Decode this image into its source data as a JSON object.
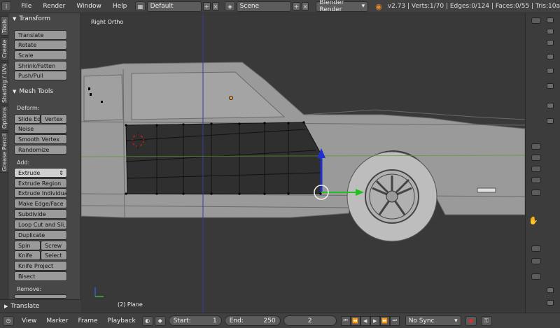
{
  "topbar": {
    "menus": [
      "File",
      "Render",
      "Window",
      "Help"
    ],
    "layout": "Default",
    "scene": "Scene",
    "engine": "Blender Render",
    "stats": "v2.73 | Verts:1/70 | Edges:0/124 | Faces:0/55 | Tris:10a"
  },
  "vtabs": [
    "Tools",
    "Create",
    "Shading / UVs",
    "Options",
    "Grease Pencil"
  ],
  "tools": {
    "transform": {
      "title": "Transform",
      "buttons": [
        "Translate",
        "Rotate",
        "Scale",
        "Shrink/Fatten",
        "Push/Pull"
      ]
    },
    "mesh_tools": {
      "title": "Mesh Tools",
      "deform_label": "Deform:",
      "slide_edge": "Slide Ed",
      "vertex": "Vertex",
      "noise": "Noise",
      "smooth_vertex": "Smooth Vertex",
      "randomize": "Randomize",
      "add_label": "Add:",
      "extrude": "Extrude",
      "extrude_region": "Extrude Region",
      "extrude_individual": "Extrude Individual",
      "make_edge_face": "Make Edge/Face",
      "subdivide": "Subdivide",
      "loop_cut": "Loop Cut and Sli...",
      "duplicate": "Duplicate",
      "spin": "Spin",
      "screw": "Screw",
      "knife": "Knife",
      "select": "Select",
      "knife_project": "Knife Project",
      "bisect": "Bisect",
      "remove_label": "Remove:"
    }
  },
  "operator_panel": "Translate",
  "viewport": {
    "view_label": "Right Ortho",
    "object_label": "(2) Plane"
  },
  "timeline": {
    "menus": [
      "View",
      "Marker",
      "Frame",
      "Playback"
    ],
    "start_label": "Start:",
    "start_value": "1",
    "end_label": "End:",
    "end_value": "250",
    "current_frame": "2",
    "sync": "No Sync"
  },
  "colors": {
    "viewport_bg": "#393939",
    "mesh_face": "#2e2e2e",
    "car_body": "#9a9a9a",
    "axis_y": "#3a3aa8",
    "axis_z_line": "#5a9a2a",
    "gizmo_z": "#2030d0",
    "gizmo_y": "#20c020"
  }
}
